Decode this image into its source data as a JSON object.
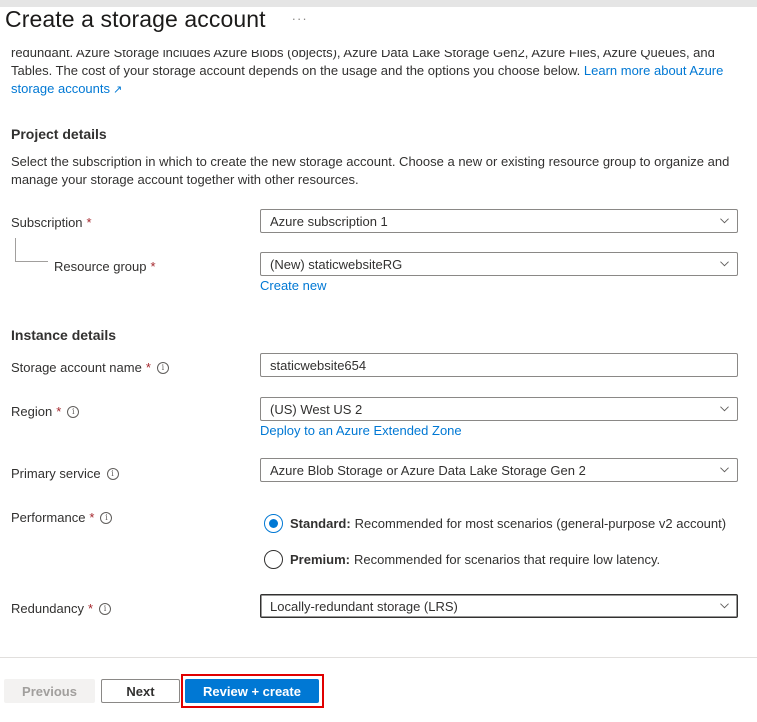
{
  "header": {
    "title": "Create a storage account",
    "more_label": "···"
  },
  "intro": {
    "line1": "redundant. Azure Storage includes Azure Blobs (objects), Azure Data Lake Storage Gen2, Azure Files, Azure Queues, and Azure",
    "line2_text": "Tables. The cost of your storage account depends on the usage and the options you choose below. ",
    "link_text_a": "Learn more about Azure",
    "link_text_b": "storage accounts",
    "ext_icon": "↗"
  },
  "project": {
    "title": "Project details",
    "description": "Select the subscription in which to create the new storage account. Choose a new or existing resource group to organize and manage your storage account together with other resources.",
    "subscription": {
      "label": "Subscription",
      "required": "*",
      "value": "Azure subscription 1"
    },
    "resource_group": {
      "label": "Resource group",
      "required": "*",
      "value": "(New) staticwebsiteRG",
      "link": "Create new"
    }
  },
  "instance": {
    "title": "Instance details",
    "storage_name": {
      "label": "Storage account name",
      "required": "*",
      "value": "staticwebsite654"
    },
    "region": {
      "label": "Region",
      "required": "*",
      "value": "(US) West US 2",
      "link": "Deploy to an Azure Extended Zone"
    },
    "primary_service": {
      "label": "Primary service",
      "value": "Azure Blob Storage or Azure Data Lake Storage Gen 2"
    },
    "performance": {
      "label": "Performance",
      "required": "*",
      "options": [
        {
          "name": "Standard:",
          "desc": "Recommended for most scenarios (general-purpose v2 account)",
          "checked": true
        },
        {
          "name": "Premium:",
          "desc": "Recommended for scenarios that require low latency.",
          "checked": false
        }
      ]
    },
    "redundancy": {
      "label": "Redundancy",
      "required": "*",
      "value": "Locally-redundant storage (LRS)"
    }
  },
  "info_icon": "i",
  "footer": {
    "previous": "Previous",
    "next": "Next",
    "review_create": "Review + create"
  },
  "colors": {
    "accent": "#0078d4",
    "required": "#a4262c",
    "highlight": "#e00000"
  }
}
